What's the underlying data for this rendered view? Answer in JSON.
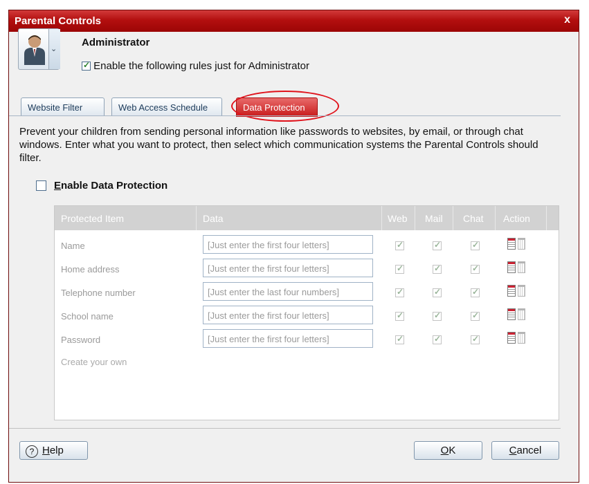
{
  "window": {
    "title": "Parental Controls",
    "close_label": "x"
  },
  "user": {
    "name": "Administrator",
    "enable_rules_label": "Enable the following rules just for Administrator",
    "enable_rules_checked": true
  },
  "tabs": [
    {
      "label": "Website Filter",
      "active": false
    },
    {
      "label": "Web Access Schedule",
      "active": false
    },
    {
      "label": "Data Protection",
      "active": true
    }
  ],
  "description": "Prevent your children from sending personal information like passwords to websites, by email, or through chat windows. Enter what you want to protect, then select which communication systems the Parental Controls should filter.",
  "enable_data_protection": {
    "label_first": "E",
    "label_rest": "nable Data Protection",
    "checked": false
  },
  "table": {
    "headers": {
      "item": "Protected Item",
      "data": "Data",
      "web": "Web",
      "mail": "Mail",
      "chat": "Chat",
      "action": "Action"
    },
    "rows": [
      {
        "item": "Name",
        "data": "[Just enter the first four letters]",
        "web": true,
        "mail": true,
        "chat": true
      },
      {
        "item": "Home address",
        "data": "[Just enter the first four letters]",
        "web": true,
        "mail": true,
        "chat": true
      },
      {
        "item": "Telephone number",
        "data": "[Just enter the last four numbers]",
        "web": true,
        "mail": true,
        "chat": true
      },
      {
        "item": "School name",
        "data": "[Just enter the first four letters]",
        "web": true,
        "mail": true,
        "chat": true
      },
      {
        "item": "Password",
        "data": "[Just enter the first four letters]",
        "web": true,
        "mail": true,
        "chat": true
      }
    ],
    "create_own": "Create your own"
  },
  "buttons": {
    "help_icon": "?",
    "help_first": "H",
    "help_rest": "elp",
    "ok_first": "O",
    "ok_rest": "K",
    "cancel_first": "C",
    "cancel_rest": "ancel"
  },
  "colors": {
    "titlebar": "#b30f0f",
    "active_tab": "#c81a1a",
    "highlight_ring": "#e0121b"
  }
}
